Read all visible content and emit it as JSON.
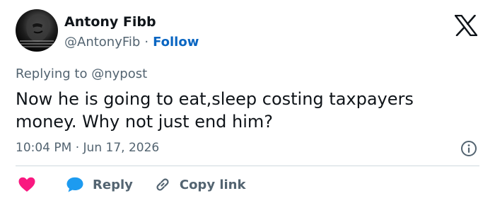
{
  "author": {
    "name": "Antony Fibb",
    "handle": "@AntonyFib",
    "separator": "·",
    "follow_label": "Follow"
  },
  "reply_context": {
    "prefix": "Replying to",
    "mention": "@nypost"
  },
  "tweet": {
    "text": "Now he is going to eat,sleep costing taxpayers money.  Why not just end him?"
  },
  "meta": {
    "time": "10:04 PM",
    "separator": "·",
    "date": "Jun 17, 2026"
  },
  "actions": {
    "reply_label": "Reply",
    "copy_link_label": "Copy link"
  },
  "icons": {
    "logo": "x-logo-icon",
    "info": "info-icon",
    "like": "heart-icon",
    "reply": "speech-bubble-icon",
    "link": "link-icon"
  },
  "colors": {
    "text": "#0f1419",
    "secondary": "#536471",
    "follow": "#0a66c2",
    "heart": "#f91880",
    "reply_bubble": "#1d9bf0",
    "divider": "#cfd9de"
  }
}
